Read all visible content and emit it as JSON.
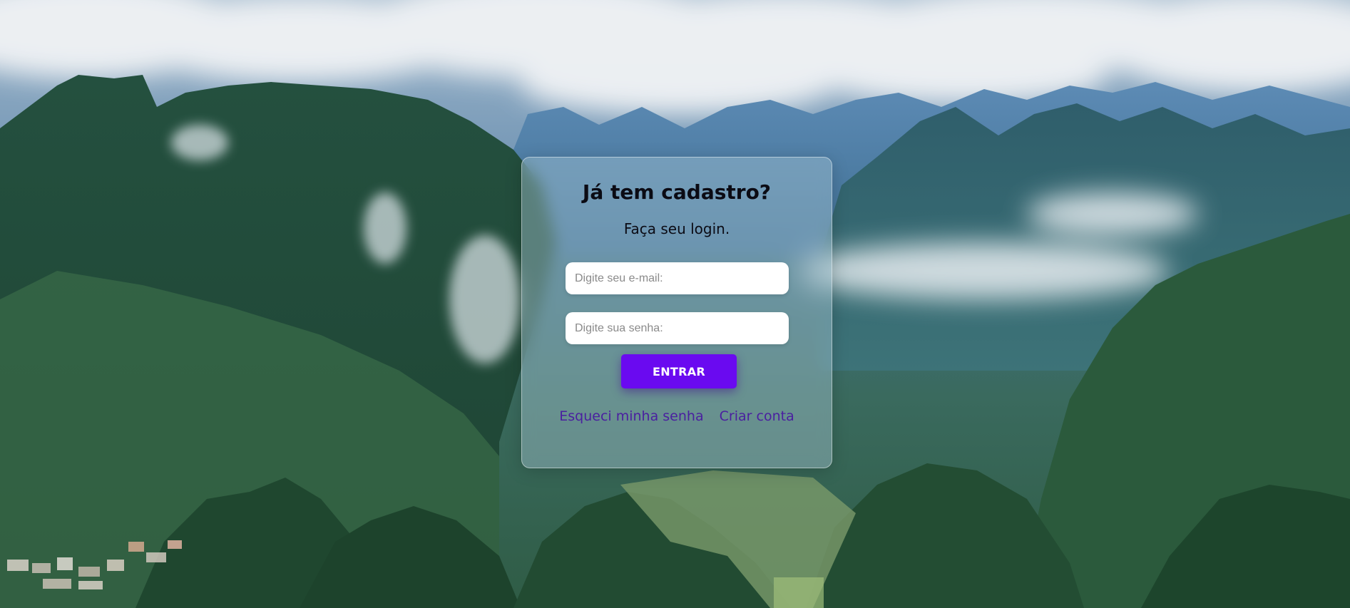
{
  "login": {
    "title": "Já tem cadastro?",
    "subtitle": "Faça seu login.",
    "email_placeholder": "Digite seu e-mail:",
    "password_placeholder": "Digite sua senha:",
    "submit_label": "ENTRAR",
    "forgot_password_label": "Esqueci minha senha",
    "create_account_label": "Criar conta"
  },
  "colors": {
    "accent": "#6a0af0",
    "link": "#4a1fa0",
    "title": "#0b0b14"
  }
}
